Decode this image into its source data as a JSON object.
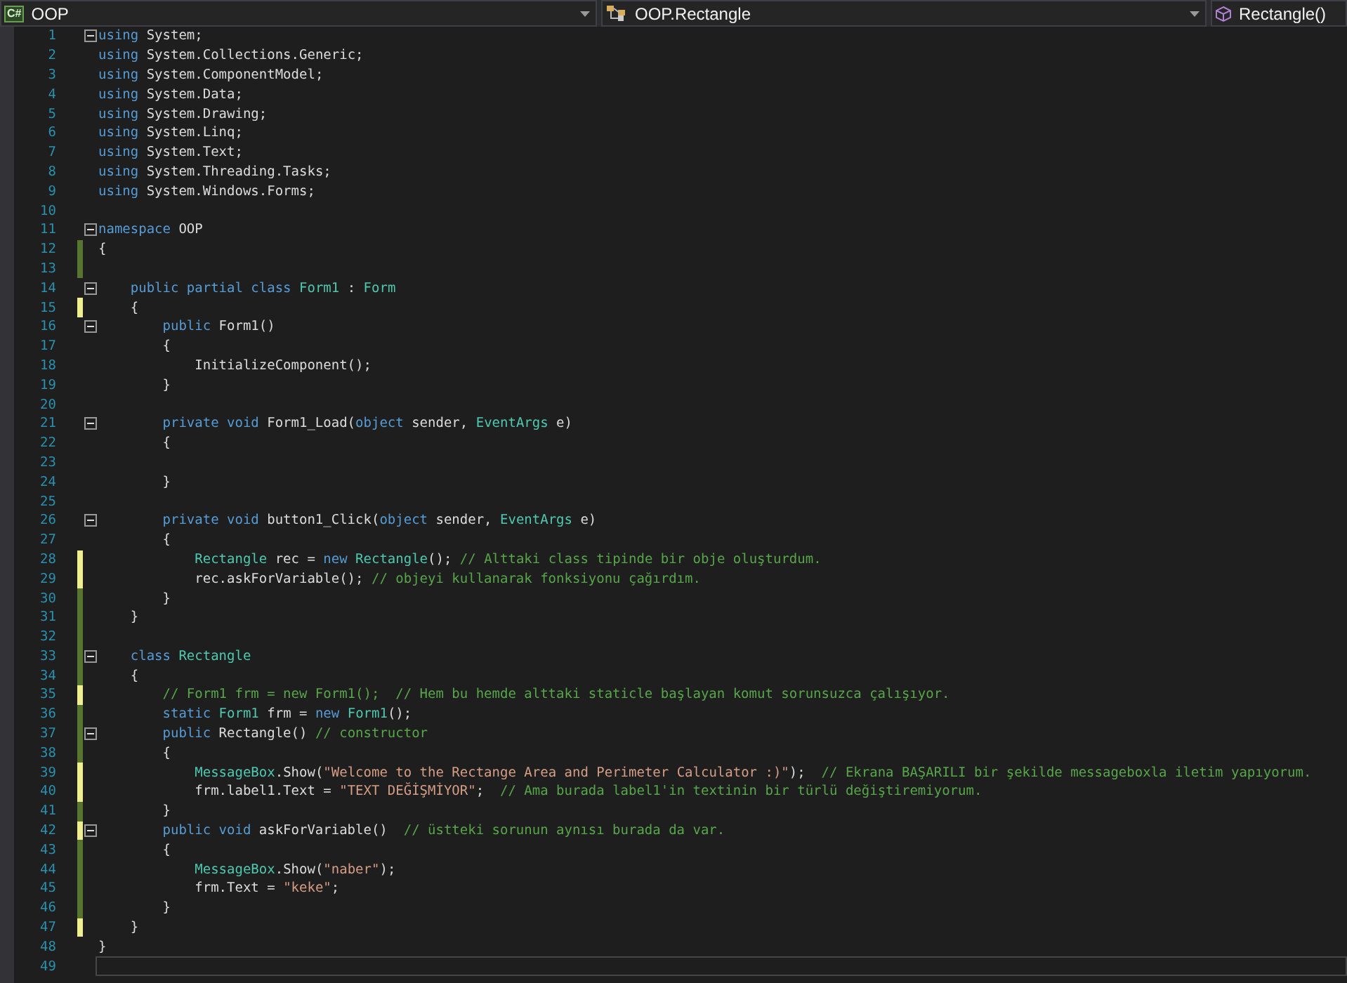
{
  "navigation_bar": {
    "project": {
      "icon_label": "C#",
      "label": "OOP"
    },
    "type": {
      "label": "OOP.Rectangle"
    },
    "member": {
      "label": "Rectangle()"
    }
  },
  "editor": {
    "lines": [
      {
        "n": "1",
        "fold": true,
        "changed": false,
        "current": false,
        "tokens": [
          {
            "kind": "keyword",
            "text": "using"
          },
          {
            "kind": "plain",
            "text": " System;"
          }
        ]
      },
      {
        "n": "2",
        "fold": false,
        "changed": false,
        "current": false,
        "tokens": [
          {
            "kind": "keyword",
            "text": "using"
          },
          {
            "kind": "plain",
            "text": " System.Collections.Generic;"
          }
        ]
      },
      {
        "n": "3",
        "fold": false,
        "changed": false,
        "current": false,
        "tokens": [
          {
            "kind": "keyword",
            "text": "using"
          },
          {
            "kind": "plain",
            "text": " System.ComponentModel;"
          }
        ]
      },
      {
        "n": "4",
        "fold": false,
        "changed": false,
        "current": false,
        "tokens": [
          {
            "kind": "keyword",
            "text": "using"
          },
          {
            "kind": "plain",
            "text": " System.Data;"
          }
        ]
      },
      {
        "n": "5",
        "fold": false,
        "changed": false,
        "current": false,
        "tokens": [
          {
            "kind": "keyword",
            "text": "using"
          },
          {
            "kind": "plain",
            "text": " System.Drawing;"
          }
        ]
      },
      {
        "n": "6",
        "fold": false,
        "changed": false,
        "current": false,
        "tokens": [
          {
            "kind": "keyword",
            "text": "using"
          },
          {
            "kind": "plain",
            "text": " System.Linq;"
          }
        ]
      },
      {
        "n": "7",
        "fold": false,
        "changed": false,
        "current": false,
        "tokens": [
          {
            "kind": "keyword",
            "text": "using"
          },
          {
            "kind": "plain",
            "text": " System.Text;"
          }
        ]
      },
      {
        "n": "8",
        "fold": false,
        "changed": false,
        "current": false,
        "tokens": [
          {
            "kind": "keyword",
            "text": "using"
          },
          {
            "kind": "plain",
            "text": " System.Threading.Tasks;"
          }
        ]
      },
      {
        "n": "9",
        "fold": false,
        "changed": false,
        "current": false,
        "tokens": [
          {
            "kind": "keyword",
            "text": "using"
          },
          {
            "kind": "plain",
            "text": " System.Windows.Forms;"
          }
        ]
      },
      {
        "n": "10",
        "fold": false,
        "changed": false,
        "current": false
      },
      {
        "n": "11",
        "fold": true,
        "changed": false,
        "current": false,
        "tokens": [
          {
            "kind": "keyword",
            "text": "namespace"
          },
          {
            "kind": "plain",
            "text": " OOP"
          }
        ]
      },
      {
        "n": "12",
        "fold": false,
        "changed": true,
        "saved": true,
        "current": false,
        "tokens": [
          {
            "kind": "plain",
            "text": "{"
          }
        ]
      },
      {
        "n": "13",
        "fold": false,
        "changed": true,
        "saved": true,
        "current": false
      },
      {
        "n": "14",
        "fold": true,
        "changed": false,
        "current": false,
        "tokens": [
          {
            "kind": "keyword",
            "text": "    public partial class "
          },
          {
            "kind": "type",
            "text": "Form1"
          },
          {
            "kind": "plain",
            "text": " : "
          },
          {
            "kind": "type",
            "text": "Form"
          }
        ]
      },
      {
        "n": "15",
        "fold": false,
        "changed": true,
        "saved": false,
        "current": false,
        "tokens": [
          {
            "kind": "plain",
            "text": "    {"
          }
        ]
      },
      {
        "n": "16",
        "fold": true,
        "changed": false,
        "current": false,
        "tokens": [
          {
            "kind": "keyword",
            "text": "        public"
          },
          {
            "kind": "plain",
            "text": " Form1()"
          }
        ]
      },
      {
        "n": "17",
        "fold": false,
        "changed": false,
        "current": false,
        "tokens": [
          {
            "kind": "plain",
            "text": "        {"
          }
        ]
      },
      {
        "n": "18",
        "fold": false,
        "changed": false,
        "current": false,
        "tokens": [
          {
            "kind": "plain",
            "text": "            InitializeComponent();"
          }
        ]
      },
      {
        "n": "19",
        "fold": false,
        "changed": false,
        "current": false,
        "tokens": [
          {
            "kind": "plain",
            "text": "        }"
          }
        ]
      },
      {
        "n": "20",
        "fold": false,
        "changed": false,
        "current": false
      },
      {
        "n": "21",
        "fold": true,
        "changed": false,
        "current": false,
        "tokens": [
          {
            "kind": "keyword",
            "text": "        private void"
          },
          {
            "kind": "plain",
            "text": " Form1_Load("
          },
          {
            "kind": "keyword",
            "text": "object"
          },
          {
            "kind": "plain",
            "text": " sender, "
          },
          {
            "kind": "type",
            "text": "EventArgs"
          },
          {
            "kind": "plain",
            "text": " e)"
          }
        ]
      },
      {
        "n": "22",
        "fold": false,
        "changed": false,
        "current": false,
        "tokens": [
          {
            "kind": "plain",
            "text": "        {"
          }
        ]
      },
      {
        "n": "23",
        "fold": false,
        "changed": false,
        "current": false
      },
      {
        "n": "24",
        "fold": false,
        "changed": false,
        "current": false,
        "tokens": [
          {
            "kind": "plain",
            "text": "        }"
          }
        ]
      },
      {
        "n": "25",
        "fold": false,
        "changed": false,
        "current": false
      },
      {
        "n": "26",
        "fold": true,
        "changed": false,
        "current": false,
        "tokens": [
          {
            "kind": "keyword",
            "text": "        private void"
          },
          {
            "kind": "plain",
            "text": " button1_Click("
          },
          {
            "kind": "keyword",
            "text": "object"
          },
          {
            "kind": "plain",
            "text": " sender, "
          },
          {
            "kind": "type",
            "text": "EventArgs"
          },
          {
            "kind": "plain",
            "text": " e)"
          }
        ]
      },
      {
        "n": "27",
        "fold": false,
        "changed": false,
        "current": false,
        "tokens": [
          {
            "kind": "plain",
            "text": "        {"
          }
        ]
      },
      {
        "n": "28",
        "fold": false,
        "changed": true,
        "saved": false,
        "current": false,
        "tokens": [
          {
            "kind": "type",
            "text": "            Rectangle"
          },
          {
            "kind": "plain",
            "text": " rec = "
          },
          {
            "kind": "keyword",
            "text": "new"
          },
          {
            "kind": "type",
            "text": " Rectangle"
          },
          {
            "kind": "plain",
            "text": "(); "
          },
          {
            "kind": "comment",
            "text": "// Alttaki class tipinde bir obje oluşturdum."
          }
        ]
      },
      {
        "n": "29",
        "fold": false,
        "changed": true,
        "saved": false,
        "current": false,
        "tokens": [
          {
            "kind": "plain",
            "text": "            rec.askForVariable(); "
          },
          {
            "kind": "comment",
            "text": "// objeyi kullanarak fonksiyonu çağırdım."
          }
        ]
      },
      {
        "n": "30",
        "fold": false,
        "changed": true,
        "saved": true,
        "current": false,
        "tokens": [
          {
            "kind": "plain",
            "text": "        }"
          }
        ]
      },
      {
        "n": "31",
        "fold": false,
        "changed": true,
        "saved": true,
        "current": false,
        "tokens": [
          {
            "kind": "plain",
            "text": "    }"
          }
        ]
      },
      {
        "n": "32",
        "fold": false,
        "changed": true,
        "saved": true,
        "current": false
      },
      {
        "n": "33",
        "fold": true,
        "changed": true,
        "saved": true,
        "current": false,
        "tokens": [
          {
            "kind": "keyword",
            "text": "    class"
          },
          {
            "kind": "type",
            "text": " Rectangle"
          }
        ]
      },
      {
        "n": "34",
        "fold": false,
        "changed": true,
        "saved": true,
        "current": false,
        "tokens": [
          {
            "kind": "plain",
            "text": "    {"
          }
        ]
      },
      {
        "n": "35",
        "fold": false,
        "changed": true,
        "saved": false,
        "current": false,
        "tokens": [
          {
            "kind": "comment",
            "text": "        // Form1 frm = new Form1();  // Hem bu hemde alttaki staticle başlayan komut sorunsuzca çalışıyor."
          }
        ]
      },
      {
        "n": "36",
        "fold": false,
        "changed": true,
        "saved": true,
        "current": false,
        "tokens": [
          {
            "kind": "keyword",
            "text": "        static"
          },
          {
            "kind": "type",
            "text": " Form1"
          },
          {
            "kind": "plain",
            "text": " frm = "
          },
          {
            "kind": "keyword",
            "text": "new"
          },
          {
            "kind": "type",
            "text": " Form1"
          },
          {
            "kind": "plain",
            "text": "();"
          }
        ]
      },
      {
        "n": "37",
        "fold": true,
        "changed": true,
        "saved": true,
        "current": false,
        "tokens": [
          {
            "kind": "keyword",
            "text": "        public"
          },
          {
            "kind": "plain",
            "text": " Rectangle() "
          },
          {
            "kind": "comment",
            "text": "// constructor"
          }
        ]
      },
      {
        "n": "38",
        "fold": false,
        "changed": true,
        "saved": true,
        "current": false,
        "tokens": [
          {
            "kind": "plain",
            "text": "        {"
          }
        ]
      },
      {
        "n": "39",
        "fold": false,
        "changed": true,
        "saved": false,
        "current": false,
        "tokens": [
          {
            "kind": "type",
            "text": "            MessageBox"
          },
          {
            "kind": "plain",
            "text": ".Show("
          },
          {
            "kind": "string",
            "text": "\"Welcome to the Rectange Area and Perimeter Calculator :)\""
          },
          {
            "kind": "plain",
            "text": ");  "
          },
          {
            "kind": "comment",
            "text": "// Ekrana BAŞARILI bir şekilde messageboxla iletim yapıyorum."
          }
        ]
      },
      {
        "n": "40",
        "fold": false,
        "changed": true,
        "saved": false,
        "current": false,
        "tokens": [
          {
            "kind": "plain",
            "text": "            frm.label1.Text = "
          },
          {
            "kind": "string",
            "text": "\"TEXT DEĞİŞMİYOR\""
          },
          {
            "kind": "plain",
            "text": ";  "
          },
          {
            "kind": "comment",
            "text": "// Ama burada label1'in textinin bir türlü değiştiremiyorum."
          }
        ]
      },
      {
        "n": "41",
        "fold": false,
        "changed": true,
        "saved": true,
        "current": false,
        "tokens": [
          {
            "kind": "plain",
            "text": "        }"
          }
        ]
      },
      {
        "n": "42",
        "fold": true,
        "changed": true,
        "saved": false,
        "current": false,
        "tokens": [
          {
            "kind": "keyword",
            "text": "        public void"
          },
          {
            "kind": "plain",
            "text": " askForVariable()  "
          },
          {
            "kind": "comment",
            "text": "// üstteki sorunun aynısı burada da var."
          }
        ]
      },
      {
        "n": "43",
        "fold": false,
        "changed": true,
        "saved": true,
        "current": false,
        "tokens": [
          {
            "kind": "plain",
            "text": "        {"
          }
        ]
      },
      {
        "n": "44",
        "fold": false,
        "changed": true,
        "saved": true,
        "current": false,
        "tokens": [
          {
            "kind": "type",
            "text": "            MessageBox"
          },
          {
            "kind": "plain",
            "text": ".Show("
          },
          {
            "kind": "string",
            "text": "\"naber\""
          },
          {
            "kind": "plain",
            "text": ");"
          }
        ]
      },
      {
        "n": "45",
        "fold": false,
        "changed": true,
        "saved": true,
        "current": false,
        "tokens": [
          {
            "kind": "plain",
            "text": "            frm.Text = "
          },
          {
            "kind": "string",
            "text": "\"keke\""
          },
          {
            "kind": "plain",
            "text": ";"
          }
        ]
      },
      {
        "n": "46",
        "fold": false,
        "changed": true,
        "saved": true,
        "current": false,
        "tokens": [
          {
            "kind": "plain",
            "text": "        }"
          }
        ]
      },
      {
        "n": "47",
        "fold": false,
        "changed": true,
        "saved": false,
        "current": false,
        "tokens": [
          {
            "kind": "plain",
            "text": "    }"
          }
        ]
      },
      {
        "n": "48",
        "fold": false,
        "changed": false,
        "current": false,
        "tokens": [
          {
            "kind": "plain",
            "text": "}"
          }
        ]
      },
      {
        "n": "49",
        "fold": false,
        "changed": false,
        "current": true
      }
    ]
  }
}
